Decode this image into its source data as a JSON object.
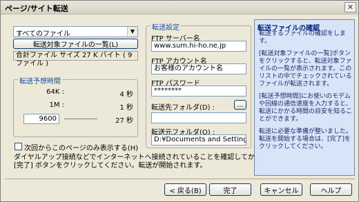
{
  "window": {
    "title": "ページ/サイト転送"
  },
  "file_select": {
    "value": "すべてのファイル"
  },
  "file_list_button": "転送対象ファイルの一覧(L)",
  "total_size": "合計ファイル サイズ 27 K バイト ( 9 ファイル )",
  "estimate": {
    "legend": "転送予想時間",
    "rows": [
      {
        "label": "64K :",
        "time": "4 秒"
      },
      {
        "label": "1M :",
        "time": "1 秒"
      }
    ],
    "custom_speed": "9600",
    "custom_time": "27 秒"
  },
  "checkbox_label": "次回からこのページのみ表示する(H)",
  "note": "ダイヤルアップ接続などでインターネットへ接続されていることを確認してから[完了] ボタンをクリックしてください。転送が開始されます。",
  "settings": {
    "legend": "転送設定",
    "server_label": "FTP サーバー名",
    "server_value": "www.sum.hi-ho.ne.jp",
    "account_label": "FTP アカウント名",
    "account_value": "お客様のアカウント名",
    "password_label": "FTP パスワード",
    "password_value": "********",
    "dest_label": "転送先フォルダ(D) :",
    "dest_value": "",
    "browse_label": "...",
    "src_label": "転送元フォルダ(O) :",
    "src_value": "D:¥Documents and Settings¥t-haih"
  },
  "help": {
    "title": "転送ファイルの確認",
    "p1": "転送するファイルの確認をします。",
    "p2": "[転送対象ファイルの一覧]ボタンをクリックすると、転送対象ファイルの一覧が表示されます。このリストの中でチェックされているファイルが転送されます。",
    "p3": "[転送予想時間]にお使いのモデムや回線の通信速度を入力すると、転送にかかる時間の目安を知ることができます。",
    "p4": "転送に必要な準備が整いました。転送を開始する場合は、[完了]をクリックしてください。"
  },
  "buttons": {
    "back": "< 戻る(B)",
    "finish": "完了",
    "cancel": "キャンセル",
    "help": "ヘルプ"
  }
}
